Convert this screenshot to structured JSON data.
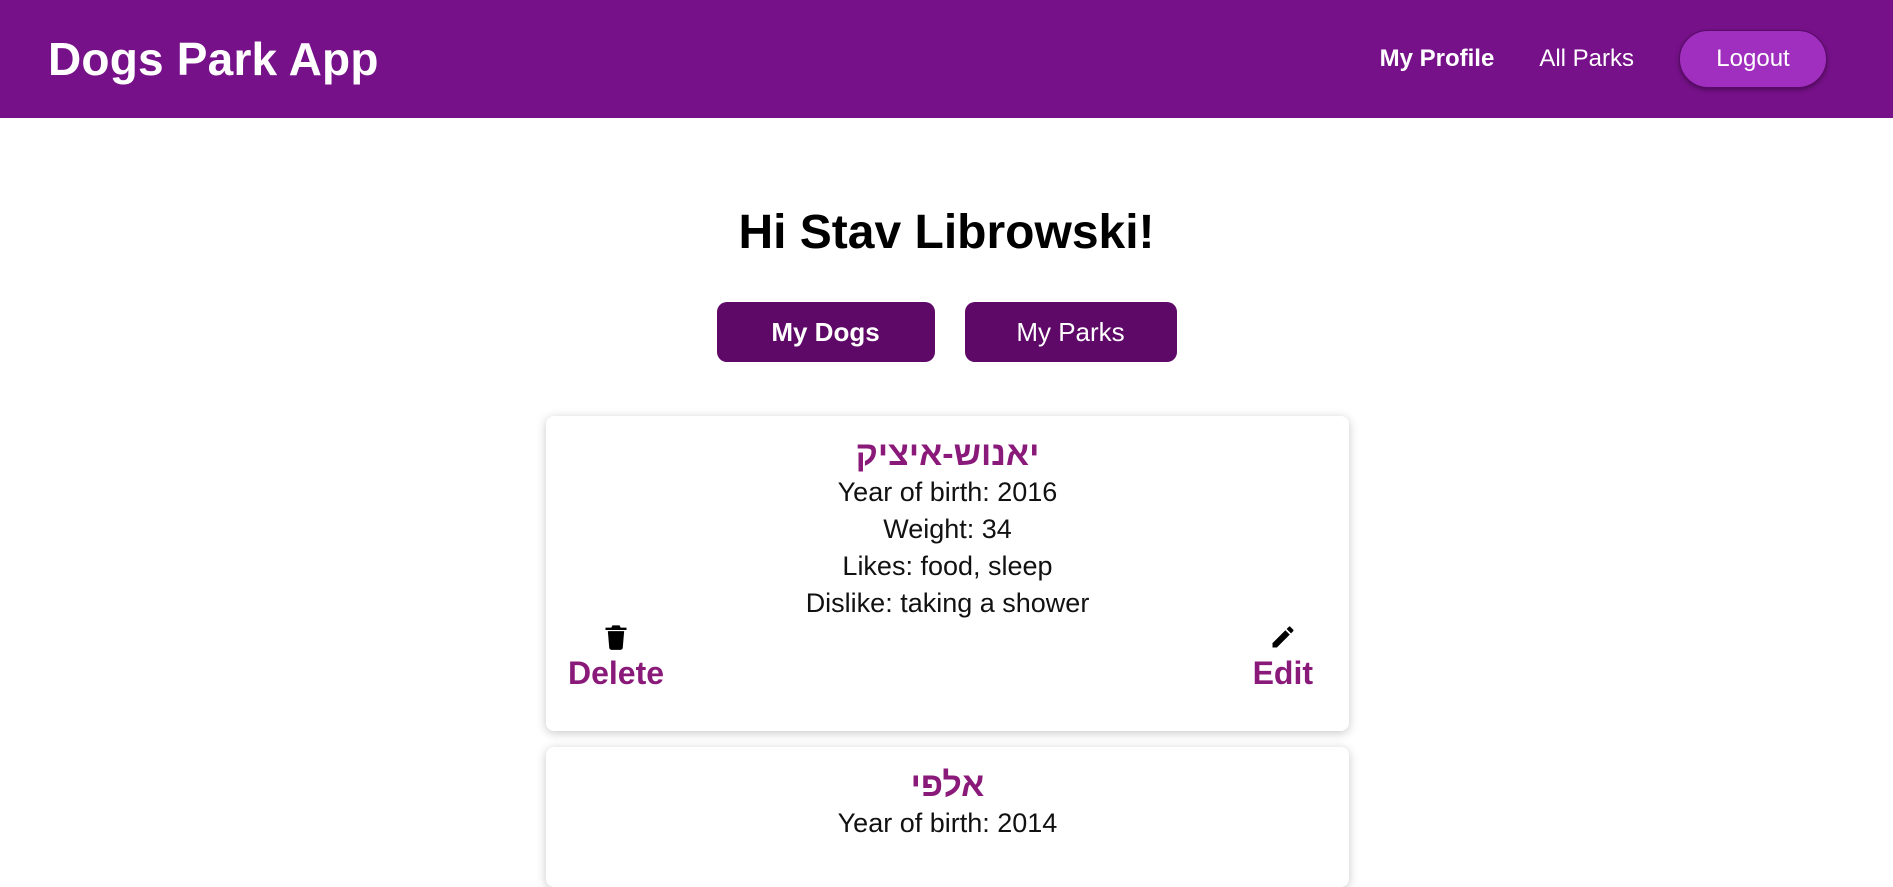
{
  "app": {
    "title": "Dogs Park App"
  },
  "nav": {
    "my_profile": "My Profile",
    "all_parks": "All Parks",
    "logout": "Logout"
  },
  "greeting": "Hi Stav Librowski!",
  "tabs": {
    "my_dogs": "My Dogs",
    "my_parks": "My Parks"
  },
  "dogs": [
    {
      "name": "יאנוש-איציק",
      "year_of_birth": "Year of birth: 2016",
      "weight": "Weight: 34",
      "likes": "Likes: food, sleep",
      "dislike": "Dislike: taking a shower",
      "delete_label": "Delete",
      "edit_label": "Edit"
    },
    {
      "name": "אלפי",
      "year_of_birth": "Year of birth: 2014"
    }
  ],
  "icons": {
    "delete": "trash-icon",
    "edit": "pencil-icon"
  },
  "colors": {
    "navbar": "#761189",
    "logout_button": "#a02fbf",
    "tab_button": "#5e0868",
    "accent_text": "#8a1a7a"
  }
}
